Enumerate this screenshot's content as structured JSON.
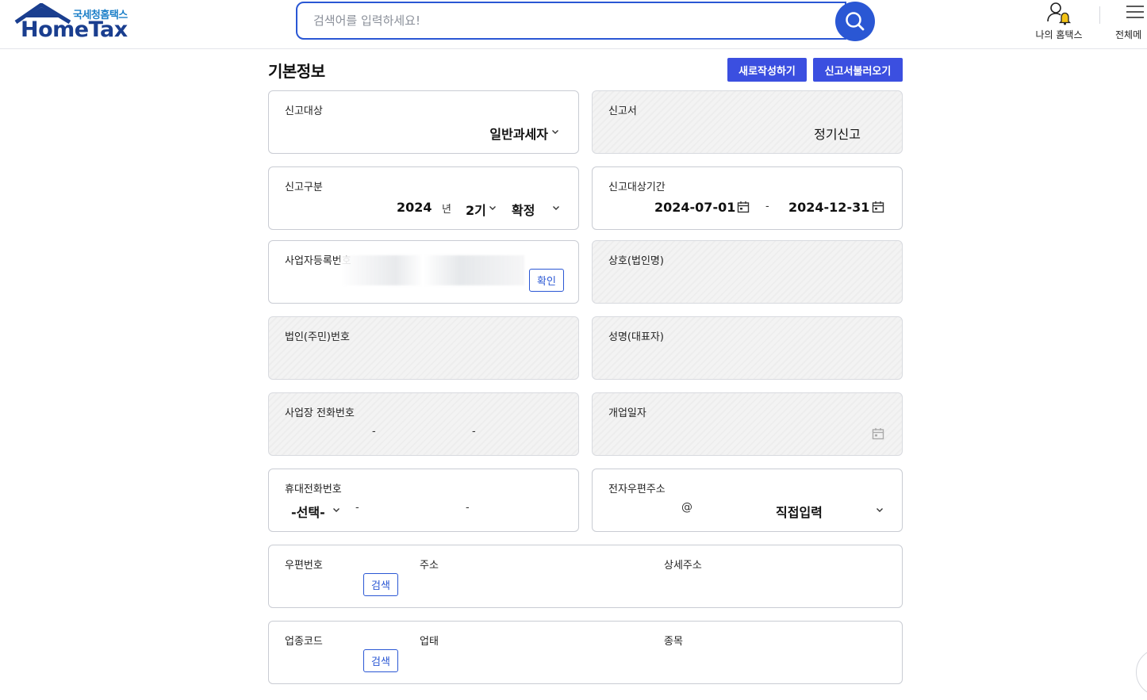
{
  "header": {
    "logo_sub": "국세청홈택스",
    "logo_main": "HomeTax",
    "search_placeholder": "검색어를 입력하세요!",
    "my_hometax": "나의 홈택스",
    "all_menu": "전체메"
  },
  "page": {
    "title": "기본정보",
    "new_btn": "새로작성하기",
    "load_btn": "신고서불러오기"
  },
  "fields": {
    "target_label": "신고대상",
    "target_value": "일반과세자",
    "report_label": "신고서",
    "report_value": "정기신고",
    "type_label": "신고구분",
    "year": "2024",
    "year_unit": "년",
    "period": "2기",
    "kind": "확정",
    "range_label": "신고대상기간",
    "date_from": "2024-07-01",
    "date_sep": "-",
    "date_to": "2024-12-31",
    "bizno_label": "사업자등록번호",
    "confirm_btn": "확인",
    "company_label": "상호(법인명)",
    "corpno_label": "법인(주민)번호",
    "name_label": "성명(대표자)",
    "phone_label": "사업장 전화번호",
    "dash": "-",
    "opendate_label": "개업일자",
    "mobile_label": "휴대전화번호",
    "mobile_select": "-선택-",
    "email_label": "전자우편주소",
    "at": "@",
    "email_domain": "직접입력",
    "zip_label": "우편번호",
    "search_btn": "검색",
    "addr_label": "주소",
    "addr_detail_label": "상세주소",
    "bizcode_label": "업종코드",
    "biztype_label": "업태",
    "bizitem_label": "종목"
  },
  "colors": {
    "primary": "#2a57d4",
    "button": "#3b4fe0",
    "logo_blue": "#1a3e8f"
  }
}
